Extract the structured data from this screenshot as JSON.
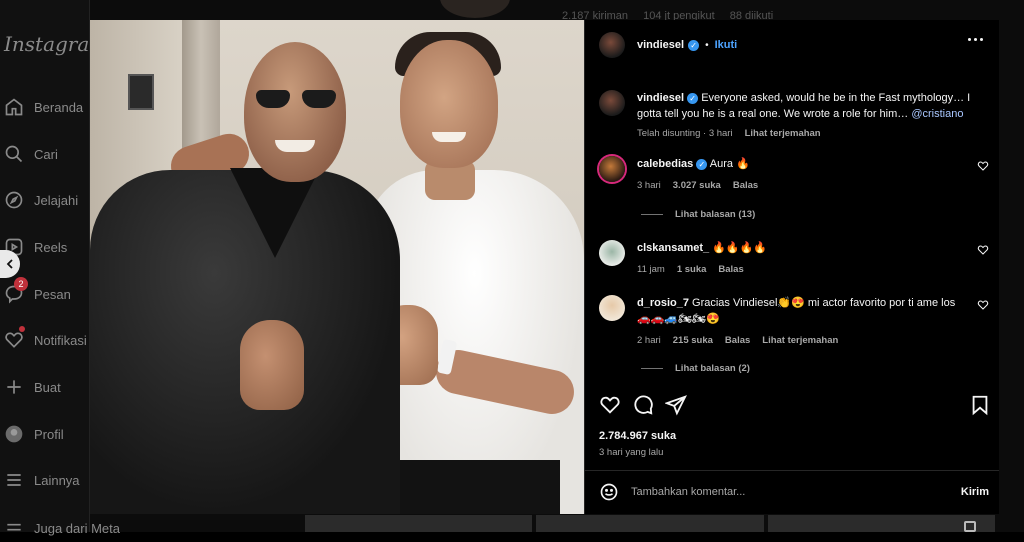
{
  "app": {
    "logo": "Instagram"
  },
  "sidebar": {
    "items": [
      {
        "label": "Beranda",
        "icon": "home-icon"
      },
      {
        "label": "Cari",
        "icon": "search-icon"
      },
      {
        "label": "Jelajahi",
        "icon": "compass-icon"
      },
      {
        "label": "Reels",
        "icon": "reels-icon"
      },
      {
        "label": "Pesan",
        "icon": "messenger-icon",
        "badge": "2"
      },
      {
        "label": "Notifikasi",
        "icon": "heart-icon"
      },
      {
        "label": "Buat",
        "icon": "plus-icon"
      },
      {
        "label": "Profil",
        "icon": "profile-avatar"
      },
      {
        "label": "Lainnya",
        "icon": "menu-icon"
      }
    ],
    "footer": "Juga dari Meta"
  },
  "profile_stats": {
    "posts": "2.187 kiriman",
    "followers": "104 jt pengikut",
    "following": "88 diikuti"
  },
  "post": {
    "author": "vindiesel",
    "follow_label": "Ikuti",
    "caption": "Everyone asked, would he be in the Fast mythology… I gotta tell you he is a real one. We wrote a role for him…",
    "caption_mention": "@cristiano",
    "caption_edited": "Telah disunting · 3 hari",
    "see_translation": "Lihat terjemahan",
    "comments": [
      {
        "user": "calebedias",
        "verified": true,
        "text": "Aura 🔥",
        "time": "3 hari",
        "likes": "3.027 suka",
        "reply": "Balas",
        "view_replies": "Lihat balasan (13)"
      },
      {
        "user": "clskansamet_",
        "verified": false,
        "text": "🔥🔥🔥🔥",
        "time": "11 jam",
        "likes": "1 suka",
        "reply": "Balas"
      },
      {
        "user": "d_rosio_7",
        "verified": false,
        "text": "Gracias Vindiesel👏😍 mi actor favorito por ti ame los 🚗🚗🚙🏍🏍😍",
        "time": "2 hari",
        "likes": "215 suka",
        "reply": "Balas",
        "translation": "Lihat terjemahan",
        "view_replies": "Lihat balasan (2)"
      }
    ],
    "likes_total": "2.784.967 suka",
    "posted_ago": "3 hari yang lalu",
    "comment_placeholder": "Tambahkan komentar...",
    "send_label": "Kirim"
  },
  "colors": {
    "link_blue": "#4da3ff",
    "verified_blue": "#3797f0",
    "badge_red": "#c0313b"
  }
}
